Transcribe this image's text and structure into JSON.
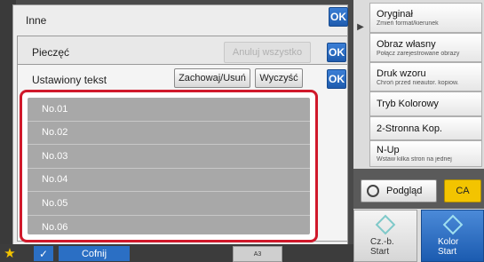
{
  "dialogs": {
    "inne_title": "Inne",
    "pieczec_title": "Pieczęć",
    "cancel_all_label": "Anuluj wszystko",
    "ustawiony_title": "Ustawiony tekst",
    "save_delete_label": "Zachowaj/Usuń",
    "clear_label": "Wyczyść",
    "ok_label": "OK"
  },
  "text_list": [
    "No.01",
    "No.02",
    "No.03",
    "No.04",
    "No.05",
    "No.06"
  ],
  "right_menu": [
    {
      "main": "Oryginał",
      "sub": "Zmień format/kierunek"
    },
    {
      "main": "Obraz własny",
      "sub": "Połącz zarejestrowane obrazy"
    },
    {
      "main": "Druk wzoru",
      "sub": "Chroń przed nieautor. kopiow."
    },
    {
      "main": "Tryb Kolorowy",
      "sub": ""
    },
    {
      "main": "2-Stronna Kop.",
      "sub": ""
    },
    {
      "main": "N-Up",
      "sub": "Wstaw kilka stron na jednej"
    }
  ],
  "preview_label": "Podgląd",
  "ca_label": "CA",
  "start_bw": {
    "line1": "Cz.-b.",
    "line2": "Start"
  },
  "start_color": {
    "line1": "Kolor",
    "line2": "Start"
  },
  "bottom_bar": {
    "back_label": "Cofnij",
    "tray_label": "A3"
  },
  "colors": {
    "highlight": "#d0192b",
    "ok": "#2b6fc4",
    "ca": "#f3c400"
  }
}
